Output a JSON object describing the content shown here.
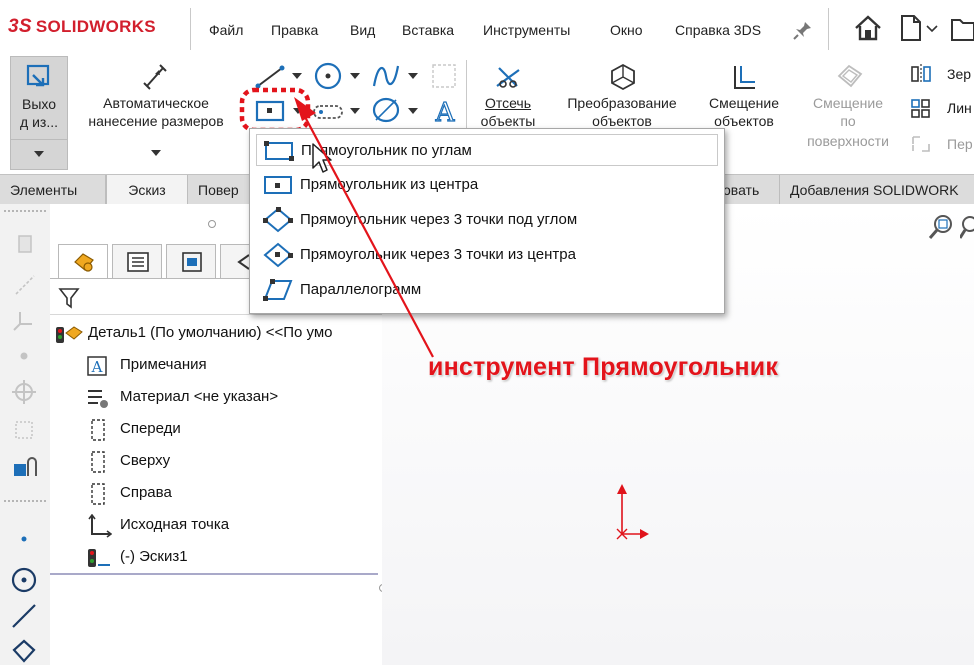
{
  "app": {
    "logo_prefix": "3S",
    "logo": "SOLIDWORKS",
    "menu": [
      "Файл",
      "Правка",
      "Вид",
      "Вставка",
      "Инструменты",
      "Окно",
      "Справка 3DS"
    ]
  },
  "ribbon": {
    "exit_sketch": {
      "line1": "Выхо",
      "line2": "д из..."
    },
    "smart_dimension": {
      "line1": "Автоматическое",
      "line2": "нанесение размеров"
    },
    "trim": {
      "line1": "Отсечь",
      "line2": "объекты"
    },
    "convert": {
      "line1": "Преобразование",
      "line2": "объектов"
    },
    "offset": {
      "line1": "Смещение",
      "line2": "объектов"
    },
    "offset_surface": {
      "line1": "Смещение",
      "line2": "по",
      "line3": "поверхности"
    },
    "mirror_label": "Зер",
    "linear_pattern_label": "Лин",
    "move_label": "Пер"
  },
  "tabs": [
    "Элементы",
    "Эскиз",
    "Повер",
    "овать",
    "Добавления SOLIDWORK"
  ],
  "active_tab_index": 1,
  "rect_dropdown": {
    "items": [
      "Прямоугольник по углам",
      "Прямоугольник из центра",
      "Прямоугольник через 3 точки под углом",
      "Прямоугольник через 3 точки из центра",
      "Параллелограмм"
    ],
    "highlighted_index": 0
  },
  "tree": {
    "root": "Деталь1 (По умолчанию) <<По умо",
    "items": [
      {
        "label": "Примечания",
        "icon": "annotations-icon"
      },
      {
        "label": "Материал <не указан>",
        "icon": "material-icon"
      },
      {
        "label": "Спереди",
        "icon": "plane-icon"
      },
      {
        "label": "Сверху",
        "icon": "plane-icon"
      },
      {
        "label": "Справа",
        "icon": "plane-icon"
      },
      {
        "label": "Исходная точка",
        "icon": "origin-icon"
      },
      {
        "label": "(-) Эскиз1",
        "icon": "sketch-icon"
      }
    ]
  },
  "annotation": {
    "text": "инструмент Прямоугольник",
    "color": "#e3141b"
  },
  "colors": {
    "accent_blue": "#1d6fb8",
    "brand_red": "#d21f2d",
    "origin_red": "#e0131b"
  }
}
